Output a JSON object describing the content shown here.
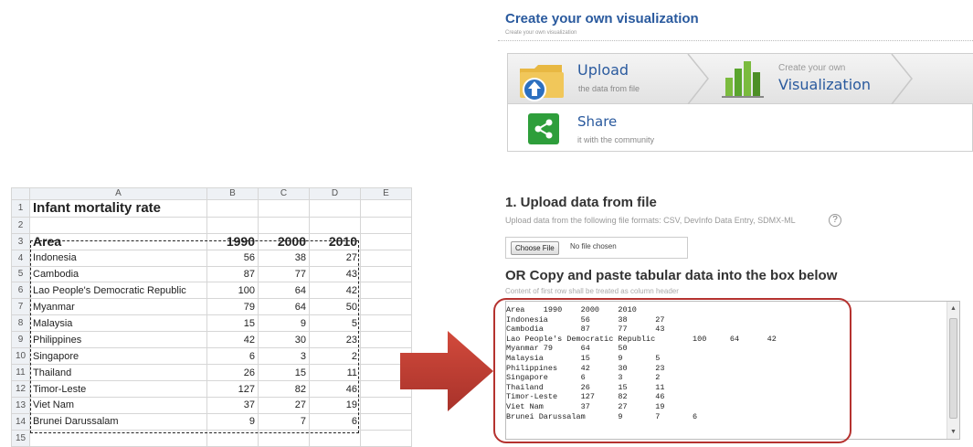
{
  "spreadsheet": {
    "column_headers": [
      "A",
      "B",
      "C",
      "D",
      "E"
    ],
    "title": "Infant mortality rate",
    "header": [
      "Area",
      "1990",
      "2000",
      "2010"
    ],
    "rows": [
      [
        "Indonesia",
        "56",
        "38",
        "27"
      ],
      [
        "Cambodia",
        "87",
        "77",
        "43"
      ],
      [
        "Lao People's Democratic Republic",
        "100",
        "64",
        "42"
      ],
      [
        "Myanmar",
        "79",
        "64",
        "50"
      ],
      [
        "Malaysia",
        "15",
        "9",
        "5"
      ],
      [
        "Philippines",
        "42",
        "30",
        "23"
      ],
      [
        "Singapore",
        "6",
        "3",
        "2"
      ],
      [
        "Thailand",
        "26",
        "15",
        "11"
      ],
      [
        "Timor-Leste",
        "127",
        "82",
        "46"
      ],
      [
        "Viet Nam",
        "37",
        "27",
        "19"
      ],
      [
        "Brunei Darussalam",
        "9",
        "7",
        "6"
      ]
    ],
    "row_numbers": [
      "1",
      "2",
      "3",
      "4",
      "5",
      "6",
      "7",
      "8",
      "9",
      "10",
      "11",
      "12",
      "13",
      "14",
      "15"
    ]
  },
  "page": {
    "title": "Create your own visualization",
    "subtitle": "Create your own visualization"
  },
  "wizard": {
    "upload_label": "Upload",
    "upload_sub": "the data from file",
    "create_small": "Create your own",
    "visualization_label": "Visualization",
    "share_label": "Share",
    "share_sub": "it with the community"
  },
  "upload": {
    "heading": "1. Upload data from file",
    "formats": "Upload data from the following file formats: CSV, DevInfo Data Entry, SDMX-ML",
    "help": "?",
    "choose_file": "Choose File",
    "no_file": "No file chosen"
  },
  "paste": {
    "heading": "OR Copy and paste tabular data into the box below",
    "hint": "Content of first row shall be treated as column header",
    "lines": [
      "Area    1990    2000    2010",
      "Indonesia       56      38      27",
      "Cambodia        87      77      43",
      "Lao People's Democratic Republic        100     64      42",
      "Myanmar 79      64      50",
      "Malaysia        15      9       5",
      "Philippines     42      30      23",
      "Singapore       6       3       2",
      "Thailand        26      15      11",
      "Timor-Leste     127     82      46",
      "Viet Nam        37      27      19",
      "Brunei Darussalam       9       7       6"
    ]
  },
  "colors": {
    "accent_blue": "#2a5a9e",
    "arrow_red": "#c0392b",
    "ring_red": "#b5322f"
  }
}
